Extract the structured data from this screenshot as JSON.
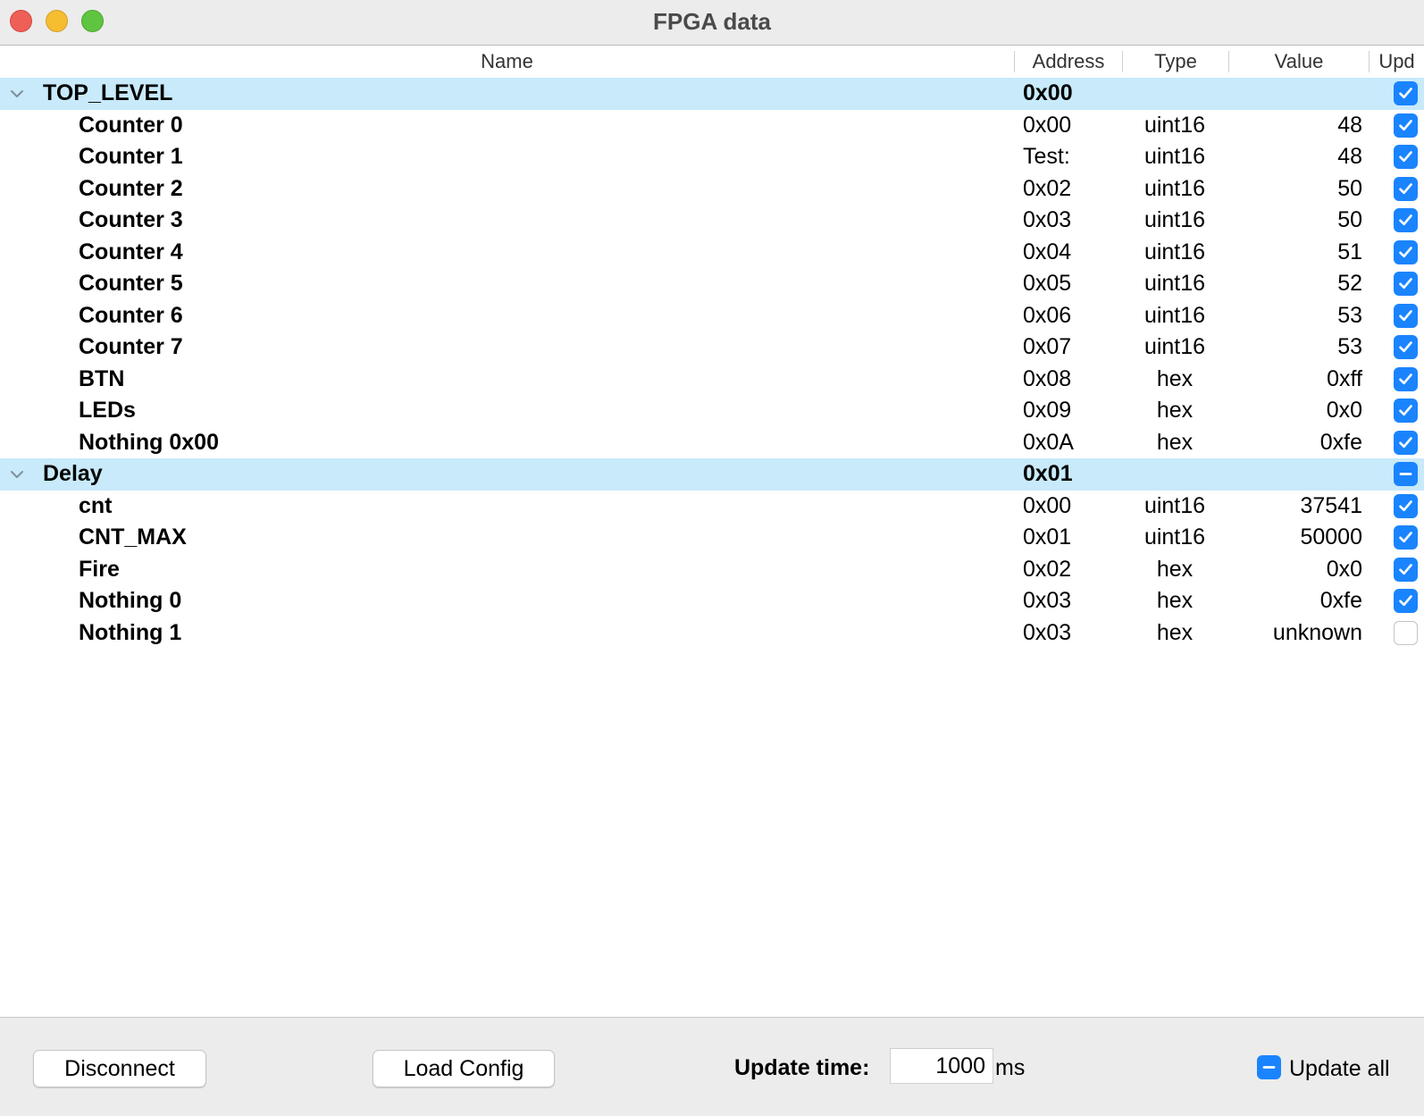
{
  "window": {
    "title": "FPGA data"
  },
  "columns": {
    "name": "Name",
    "address": "Address",
    "type": "Type",
    "value": "Value",
    "upd": "Upd"
  },
  "tree": {
    "top_level": {
      "name": "TOP_LEVEL",
      "address": "0x00",
      "checked": "on",
      "children": [
        {
          "name": "Counter 0",
          "address": "0x00",
          "type": "uint16",
          "value": "48",
          "checked": "on"
        },
        {
          "name": "Counter 1",
          "address": "Test:",
          "type": "uint16",
          "value": "48",
          "checked": "on"
        },
        {
          "name": "Counter 2",
          "address": "0x02",
          "type": "uint16",
          "value": "50",
          "checked": "on"
        },
        {
          "name": "Counter 3",
          "address": "0x03",
          "type": "uint16",
          "value": "50",
          "checked": "on"
        },
        {
          "name": "Counter 4",
          "address": "0x04",
          "type": "uint16",
          "value": "51",
          "checked": "on"
        },
        {
          "name": "Counter 5",
          "address": "0x05",
          "type": "uint16",
          "value": "52",
          "checked": "on"
        },
        {
          "name": "Counter 6",
          "address": "0x06",
          "type": "uint16",
          "value": "53",
          "checked": "on"
        },
        {
          "name": "Counter 7",
          "address": "0x07",
          "type": "uint16",
          "value": "53",
          "checked": "on"
        },
        {
          "name": "BTN",
          "address": "0x08",
          "type": "hex",
          "value": "0xff",
          "checked": "on"
        },
        {
          "name": "LEDs",
          "address": "0x09",
          "type": "hex",
          "value": "0x0",
          "checked": "on"
        },
        {
          "name": "Nothing 0x00",
          "address": "0x0A",
          "type": "hex",
          "value": "0xfe",
          "checked": "on"
        }
      ]
    },
    "delay": {
      "name": "Delay",
      "address": "0x01",
      "checked": "mixed",
      "children": [
        {
          "name": "cnt",
          "address": "0x00",
          "type": "uint16",
          "value": "37541",
          "checked": "on"
        },
        {
          "name": "CNT_MAX",
          "address": "0x01",
          "type": "uint16",
          "value": "50000",
          "checked": "on"
        },
        {
          "name": "Fire",
          "address": "0x02",
          "type": "hex",
          "value": "0x0",
          "checked": "on"
        },
        {
          "name": "Nothing 0",
          "address": "0x03",
          "type": "hex",
          "value": "0xfe",
          "checked": "on"
        },
        {
          "name": "Nothing 1",
          "address": "0x03",
          "type": "hex",
          "value": "unknown",
          "checked": "off"
        }
      ]
    }
  },
  "footer": {
    "disconnect_label": "Disconnect",
    "load_config_label": "Load Config",
    "update_time_label": "Update time:",
    "update_time_value": "1000",
    "update_time_unit": "ms",
    "update_all_label": "Update all",
    "update_all_state": "mixed"
  },
  "colors": {
    "accent": "#1a84ff",
    "group_row": "#c8eafb",
    "chrome": "#ececec"
  },
  "icons": {
    "expand": "chevron-down-icon",
    "check": "checkmark-icon",
    "mixed": "dash-icon"
  }
}
